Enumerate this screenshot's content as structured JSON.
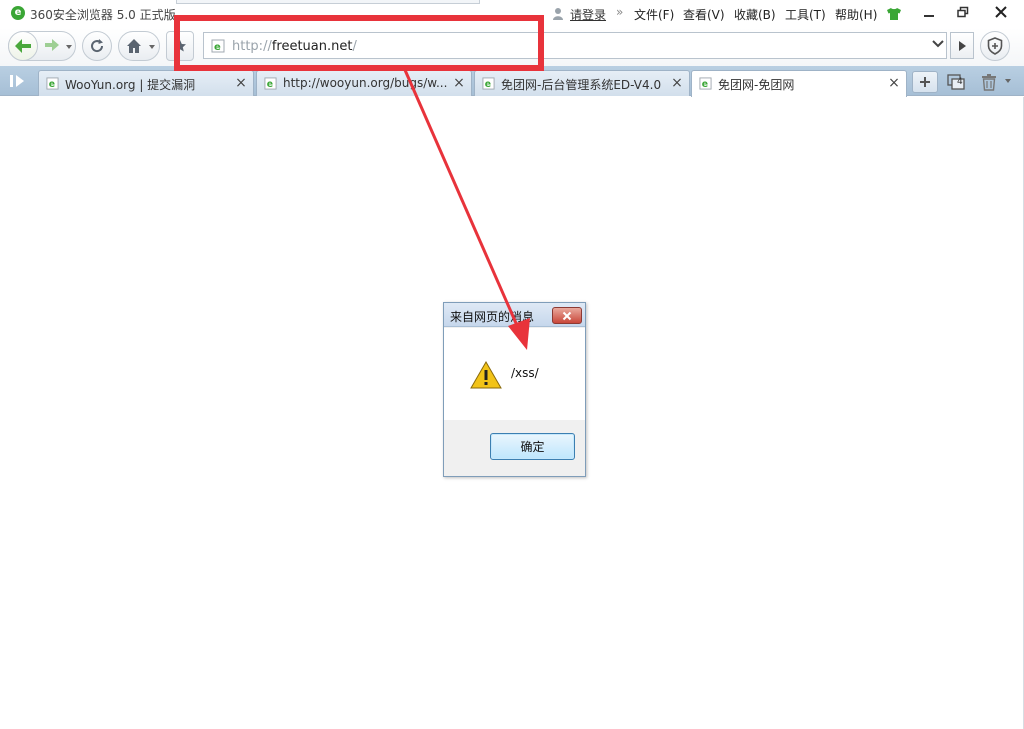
{
  "window": {
    "app_logo_glyph": "e",
    "title": "360安全浏览器 5.0 正式版",
    "login_link": "请登录",
    "menu_separator": "»",
    "menu": [
      "文件(F)",
      "查看(V)",
      "收藏(B)",
      "工具(T)",
      "帮助(H)"
    ],
    "skin_icon": "tshirt-icon",
    "controls": [
      "minimize-icon",
      "restore-icon",
      "close-icon"
    ]
  },
  "toolbar": {
    "back_icon": "back-arrow-icon",
    "forward_icon": "forward-arrow-icon",
    "refresh_icon": "refresh-icon",
    "home_icon": "home-icon",
    "favorite_icon": "star-icon",
    "address": {
      "scheme": "http://",
      "host": "freetuan.net",
      "path": "/"
    },
    "go_icon": "play-arrow-icon",
    "security_icon": "shield-icon"
  },
  "tabs": [
    {
      "label": "WooYun.org | 提交漏洞",
      "active": false
    },
    {
      "label": "http://wooyun.org/bugs/w...",
      "active": false
    },
    {
      "label": "免团网-后台管理系统ED-V4.0",
      "active": false
    },
    {
      "label": "免团网-免团网",
      "active": true
    }
  ],
  "tab_strip": {
    "new_tab_icon": "plus-icon",
    "tab_count": "4",
    "trash_icon": "trash-icon"
  },
  "dialog": {
    "title": "来自网页的消息",
    "message": "/xss/",
    "ok_label": "确定",
    "icon": "warning-icon"
  },
  "colors": {
    "annotation": "#e8333b",
    "brand_green": "#3aa635"
  }
}
